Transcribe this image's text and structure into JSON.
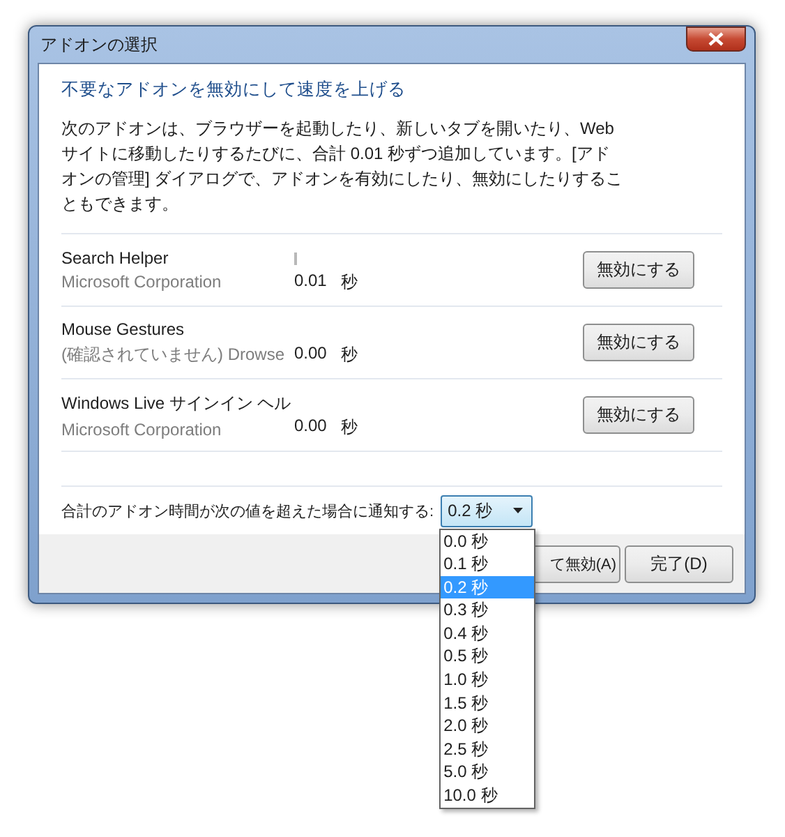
{
  "window": {
    "title": "アドオンの選択"
  },
  "heading": "不要なアドオンを無効にして速度を上げる",
  "description": "次のアドオンは、ブラウザーを起動したり、新しいタブを開いたり、Web サイトに移動したりするたびに、合計 0.01 秒ずつ追加しています。[アドオンの管理] ダイアログで、アドオンを有効にしたり、無効にしたりすることもできます。",
  "addons": [
    {
      "name": "Search Helper",
      "publisher": "Microsoft Corporation",
      "load_time": "0.01",
      "unit": "秒",
      "button": "無効にする"
    },
    {
      "name": "Mouse Gestures",
      "publisher": "(確認されていません) Drowse",
      "load_time": "0.00",
      "unit": "秒",
      "button": "無効にする"
    },
    {
      "name": "Windows Live サインイン ヘル",
      "publisher": "Microsoft Corporation",
      "load_time": "0.00",
      "unit": "秒",
      "button": "無効にする"
    }
  ],
  "notify": {
    "label": "合計のアドオン時間が次の値を超えた場合に通知する:",
    "value": "0.2 秒",
    "expanded": true,
    "options": [
      {
        "label": "0.0 秒",
        "selected": false
      },
      {
        "label": "0.1 秒",
        "selected": false
      },
      {
        "label": "0.2 秒",
        "selected": true
      },
      {
        "label": "0.3 秒",
        "selected": false
      },
      {
        "label": "0.4 秒",
        "selected": false
      },
      {
        "label": "0.5 秒",
        "selected": false
      },
      {
        "label": "1.0 秒",
        "selected": false
      },
      {
        "label": "1.5 秒",
        "selected": false
      },
      {
        "label": "2.0 秒",
        "selected": false
      },
      {
        "label": "2.5 秒",
        "selected": false
      },
      {
        "label": "5.0 秒",
        "selected": false
      },
      {
        "label": "10.0 秒",
        "selected": false
      }
    ]
  },
  "buttons": [
    {
      "label": "て無効(A)"
    },
    {
      "label": "完了(D)"
    }
  ]
}
